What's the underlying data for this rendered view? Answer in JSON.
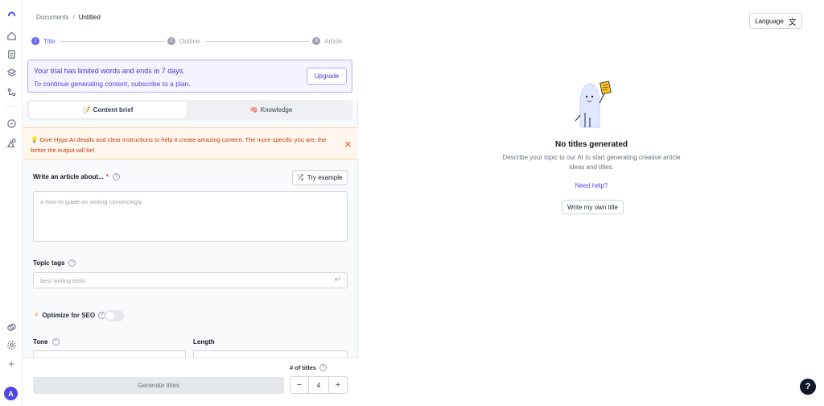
{
  "breadcrumb": {
    "root": "Documents",
    "separator": "/",
    "current": "Untitled"
  },
  "steps": [
    {
      "num": "1",
      "label": "Title"
    },
    {
      "num": "2",
      "label": "Outline"
    },
    {
      "num": "3",
      "label": "Article"
    }
  ],
  "trial": {
    "line1": "Your trial has limited words and ends in 7 days.",
    "line2": "To continue generating content, subscribe to a plan.",
    "upgrade": "Upgrade"
  },
  "tabs": [
    {
      "label": "Content brief",
      "icon": "📝"
    },
    {
      "label": "Knowledge",
      "icon": "🧠"
    }
  ],
  "tip": {
    "icon": "💡",
    "text": "Give Hypo AI details and clear instructions to help it create amazing content. The more specific you are, the better the output will be!"
  },
  "form": {
    "article_label": "Write an article about...",
    "required_mark": "*",
    "try_example": "Try example",
    "article_placeholder": "a how-to guide on writing convincingly",
    "topic_label": "Topic tags",
    "topic_placeholder": "best writing tools",
    "seo_label": "Optimize for SEO",
    "tone_label": "Tone",
    "length_label": "Length"
  },
  "footer": {
    "generate": "Generate titles",
    "titles_label": "# of titles",
    "titles_value": "4",
    "minus": "−",
    "plus": "+"
  },
  "right": {
    "language": "Language",
    "empty_title": "No titles generated",
    "empty_desc": "Describe your topic to our AI to start generating creative article ideas and titles.",
    "need_help": "Need help?",
    "own_title": "Write my own title"
  },
  "avatar": "A",
  "help_fab": "?",
  "colors": {
    "accent": "#6366f1",
    "tip_text": "#c2410c",
    "trial_border": "#a5b4fc"
  }
}
